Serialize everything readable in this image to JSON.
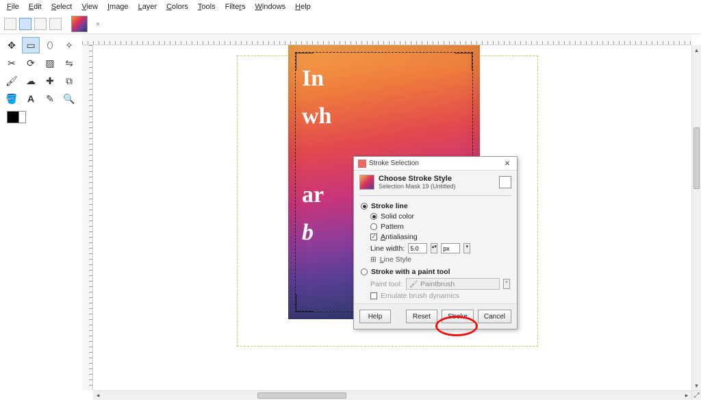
{
  "menu": {
    "items": [
      "File",
      "Edit",
      "Select",
      "View",
      "Image",
      "Layer",
      "Colors",
      "Tools",
      "Filters",
      "Windows",
      "Help"
    ]
  },
  "toolbox": {
    "tools": [
      "move",
      "rect-select",
      "free-select",
      "fuzzy-select",
      "crop",
      "rotate",
      "scale",
      "flip",
      "paintbrush",
      "smudge",
      "heal",
      "clone",
      "bucket",
      "text",
      "color-picker",
      "zoom"
    ],
    "selected_index": 1
  },
  "canvas": {
    "image_text": {
      "t1": "In",
      "t2": "wh",
      "t3": "ar",
      "t4": "b"
    }
  },
  "dialog": {
    "window_title": "Stroke Selection",
    "heading": "Choose Stroke Style",
    "subheading": "Selection Mask 19 (Untitled)",
    "stroke_line_label": "Stroke line",
    "solid_color_label": "Solid color",
    "pattern_label": "Pattern",
    "antialias_label": "Antialiasing",
    "line_width_label": "Line width:",
    "line_width_value": "5.0",
    "line_width_unit": "px",
    "line_style_label": "Line Style",
    "paint_tool_section": "Stroke with a paint tool",
    "paint_tool_label": "Paint tool:",
    "paint_tool_value": "Paintbrush",
    "emulate_label": "Emulate brush dynamics",
    "buttons": {
      "help": "Help",
      "reset": "Reset",
      "stroke": "Stroke",
      "cancel": "Cancel"
    },
    "radio_state": {
      "stroke_line": true,
      "solid_color": true,
      "pattern": false,
      "paint_tool": false
    },
    "check_state": {
      "antialias": true,
      "emulate": false
    }
  }
}
